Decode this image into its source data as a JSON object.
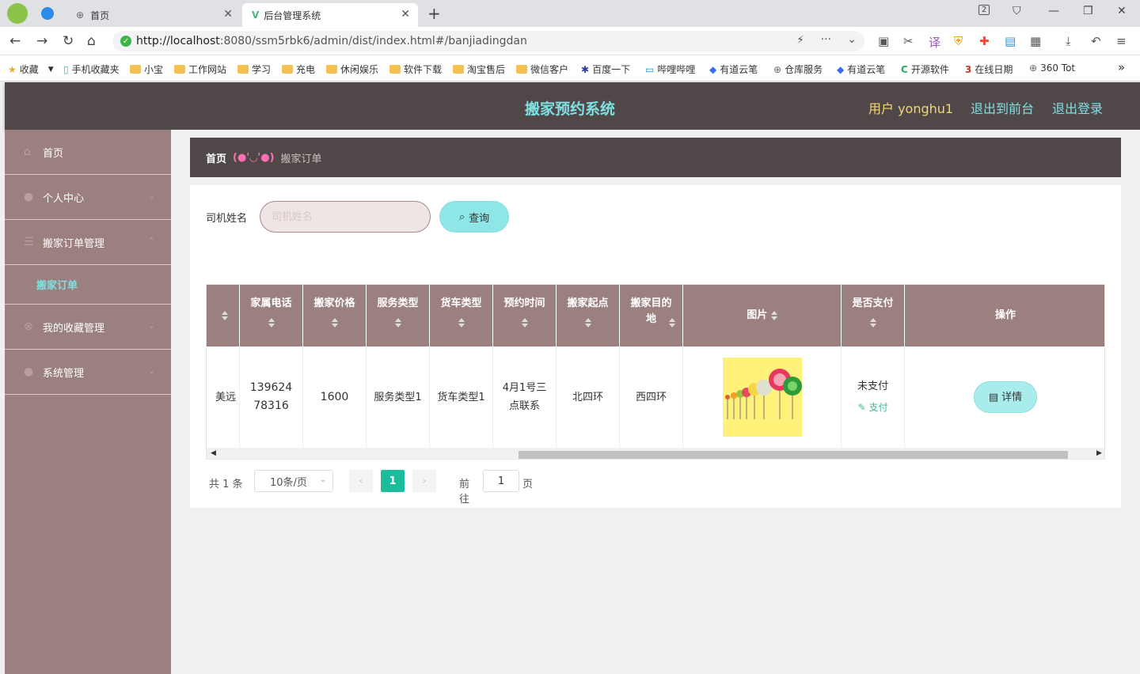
{
  "browser": {
    "tabs": [
      {
        "label": "首页"
      },
      {
        "label": "后台管理系统"
      }
    ],
    "tab_count_badge": "2",
    "url_host": "http://localhost",
    "url_rest": ":8080/ssm5rbk6/admin/dist/index.html#/banjiadingdan",
    "bookmarks": [
      "收藏",
      "手机收藏夹",
      "小宝",
      "工作网站",
      "学习",
      "充电",
      "休闲娱乐",
      "软件下载",
      "淘宝售后",
      "微信客户",
      "百度一下",
      "哔哩哔哩",
      "有道云笔",
      "仓库服务",
      "有道云笔",
      "开源软件",
      "在线日期",
      "360 Tot"
    ],
    "more": "»"
  },
  "header": {
    "title": "搬家预约系统",
    "user": "用户 yonghu1",
    "to_front": "退出到前台",
    "logout": "退出登录"
  },
  "sidebar": {
    "items": [
      {
        "label": "首页",
        "icon": "home-icon"
      },
      {
        "label": "个人中心",
        "icon": "user-icon"
      },
      {
        "label": "搬家订单管理",
        "icon": "list-icon"
      },
      {
        "label": "我的收藏管理",
        "icon": "star-icon"
      },
      {
        "label": "系统管理",
        "icon": "user-icon"
      }
    ],
    "sub_active": "搬家订单"
  },
  "breadcrumb": {
    "home": "首页",
    "sep": "(●'◡'●)",
    "current": "搬家订单"
  },
  "search": {
    "label": "司机姓名",
    "placeholder": "司机姓名",
    "button": "查询"
  },
  "table": {
    "headers": [
      "家属电话",
      "搬家价格",
      "服务类型",
      "货车类型",
      "预约时间",
      "搬家起点",
      "搬家目的地",
      "图片",
      "是否支付",
      "操作"
    ],
    "row": {
      "cut_cell": "美远",
      "phone": "13962478316",
      "price": "1600",
      "service_type": "服务类型1",
      "truck_type": "货车类型1",
      "time": "4月1号三点联系",
      "start": "北四环",
      "dest": "西四环",
      "pay_status": "未支付",
      "pay_link": "支付",
      "detail": "详情"
    }
  },
  "pager": {
    "total": "共 1 条",
    "page_size": "10条/页",
    "current": "1",
    "goto": "前往",
    "goto_value": "1",
    "page_unit": "页"
  }
}
